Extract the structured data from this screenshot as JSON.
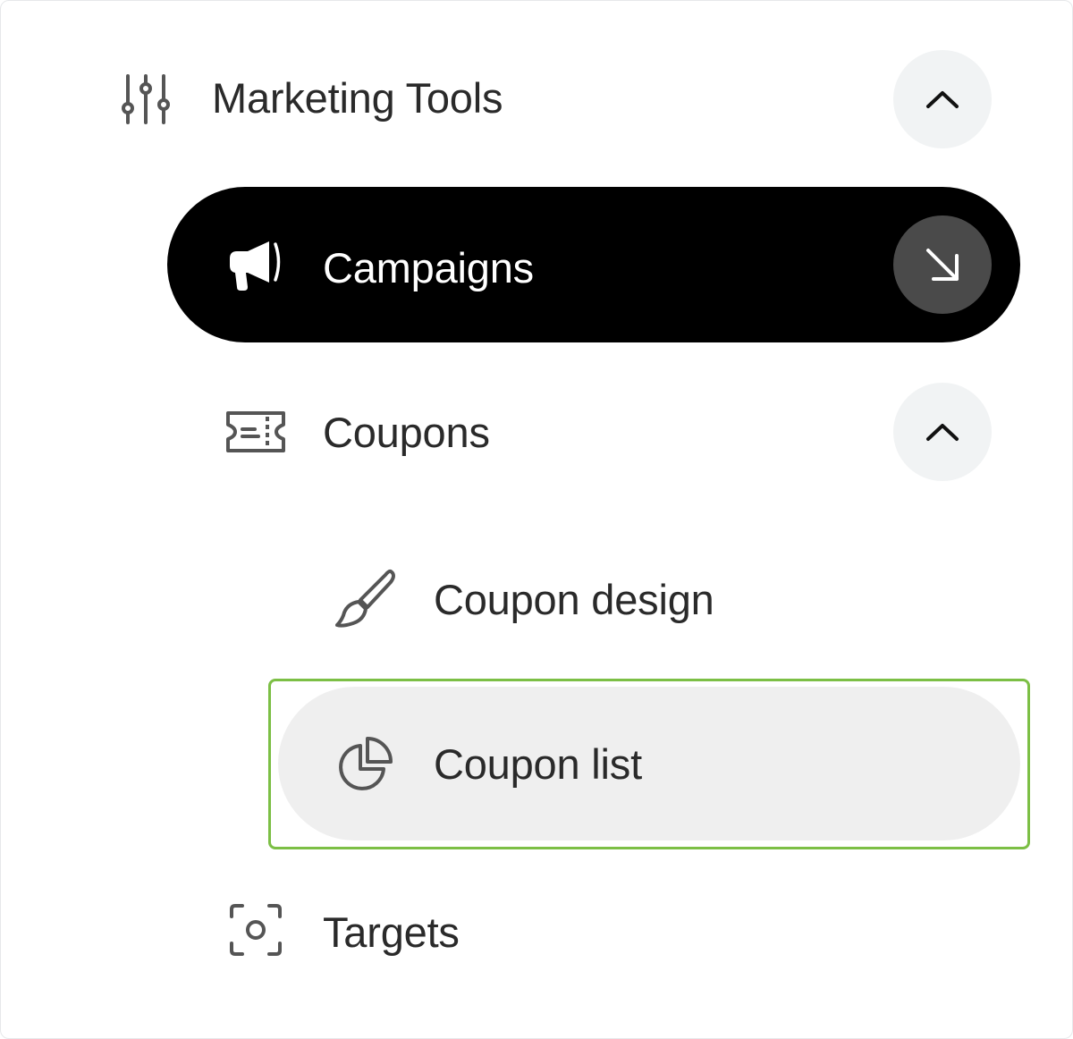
{
  "menu": {
    "section": {
      "label": "Marketing Tools",
      "icon": "sliders-icon",
      "toggle_icon": "chevron-up-icon",
      "expanded": true
    },
    "items": [
      {
        "label": "Campaigns",
        "icon": "megaphone-icon",
        "action_icon": "arrow-down-right-icon",
        "active": true
      },
      {
        "label": "Coupons",
        "icon": "ticket-icon",
        "toggle_icon": "chevron-up-icon",
        "expanded": true,
        "children": [
          {
            "label": "Coupon design",
            "icon": "paintbrush-icon"
          },
          {
            "label": "Coupon list",
            "icon": "pie-chart-icon",
            "hovered": true
          }
        ]
      },
      {
        "label": "Targets",
        "icon": "focus-target-icon"
      }
    ]
  },
  "colors": {
    "active_bg": "#000000",
    "active_text": "#ffffff",
    "hover_bg": "#efefef",
    "toggle_bg": "#f1f3f4",
    "focus_ring": "#7cbf45",
    "text": "#2a2a2a",
    "icon": "#555555"
  }
}
